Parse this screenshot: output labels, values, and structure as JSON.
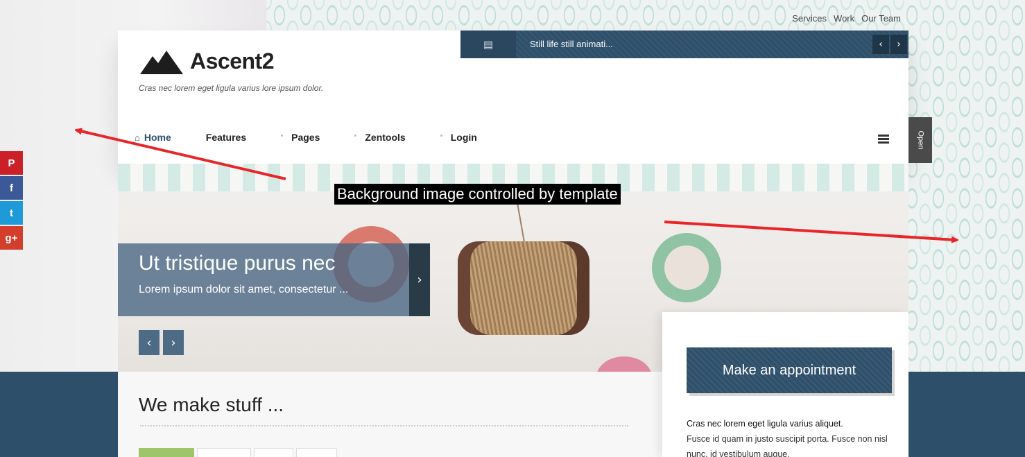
{
  "top_links": [
    "Services",
    "Work",
    "Our Team"
  ],
  "logo": {
    "name": "Ascent2",
    "tagline": "Cras nec lorem eget ligula varius lore ipsum dolor."
  },
  "ticker": {
    "icon": "newspaper-icon",
    "text": "Still life still animati...",
    "prev": "‹",
    "next": "›"
  },
  "nav": {
    "items": [
      {
        "label": "Home",
        "active": true,
        "icon": "home-icon"
      },
      {
        "label": "Features"
      },
      {
        "label": "Pages"
      },
      {
        "label": "Zentools"
      },
      {
        "label": "Login"
      }
    ],
    "menu_icon": "hamburger-icon"
  },
  "open_tab": "Open",
  "hero": {
    "annotation": "Background image controlled by template",
    "title": "Ut tristique purus nec",
    "subtitle": "Lorem ipsum dolor sit amet, consectetur ...",
    "next": "›",
    "slide_prev": "‹",
    "slide_next": "›"
  },
  "social": [
    {
      "name": "pinterest-icon",
      "glyph": "P",
      "color": "#cb2027"
    },
    {
      "name": "facebook-icon",
      "glyph": "f",
      "color": "#3b5998"
    },
    {
      "name": "twitter-icon",
      "glyph": "t",
      "color": "#1f9ad8"
    },
    {
      "name": "google-plus-icon",
      "glyph": "g+",
      "color": "#d23e2b"
    }
  ],
  "content": {
    "heading": "We make stuff ..."
  },
  "sidebar": {
    "button": "Make an appointment",
    "lead": "Cras nec lorem eget ligula varius aliquet.",
    "body": "Fusce id quam in justo suscipit porta. Fusce non nisl nunc, id vestibulum augue."
  },
  "colors": {
    "accent": "#2e4f6a",
    "annotation_arrow": "#e8262a"
  }
}
